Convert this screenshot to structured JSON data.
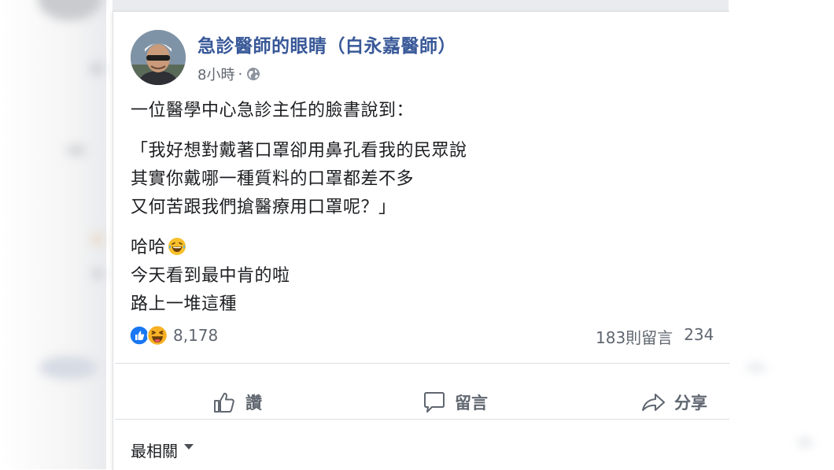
{
  "post": {
    "author": "急診醫師的眼睛（白永嘉醫師）",
    "time": "8小時",
    "separator": "·",
    "privacy_icon": "globe-icon",
    "avatar_icon": "avatar-photo",
    "intro": "一位醫學中心急診主任的臉書說到：",
    "quote_lines": [
      "「我好想對戴著口罩卻用鼻孔看我的民眾說",
      "其實你戴哪一種質料的口罩都差不多",
      "又何苦跟我們搶醫療用口罩呢？」"
    ],
    "closing_lines": [
      "哈哈",
      "今天看到最中肯的啦",
      "路上一堆這種"
    ],
    "laugh_emoji": "laughing-tears-emoji"
  },
  "reactions": {
    "icons": [
      "like-reaction-icon",
      "haha-reaction-icon"
    ],
    "count": "8,178",
    "comments": "183則留言",
    "shares": "234"
  },
  "actions": {
    "like_label": "讚",
    "comment_label": "留言",
    "share_label": "分享"
  },
  "comments_sort": {
    "label": "最相關"
  },
  "colors": {
    "author_link": "#385898",
    "secondary_text": "#606770",
    "like_blue": "#1877f2",
    "haha_yellow": "#f7b125",
    "divider": "#dadde1",
    "background": "#e9ebee"
  }
}
